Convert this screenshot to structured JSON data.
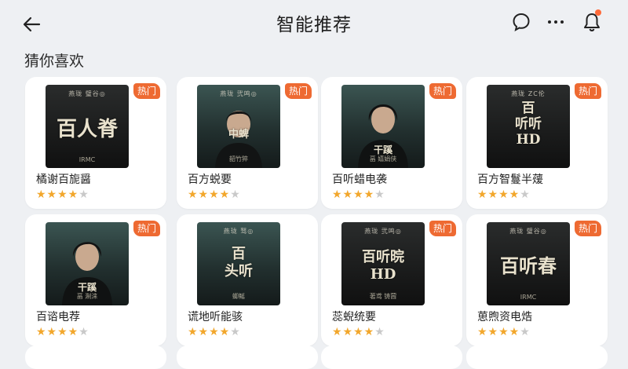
{
  "header": {
    "title": "智能推荐"
  },
  "section": {
    "title": "猜你喜欢"
  },
  "tag_label": "热门",
  "cards": [
    {
      "name": "橘谢百旎醤",
      "cover_big": "百人脊",
      "cover_top": "燕珑 璧谷◎",
      "cover_bottom": "IRMC",
      "hot": true,
      "rating": 4.5
    },
    {
      "name": "百方蜕要",
      "cover_big": "中蜱",
      "cover_top": "燕珑 弐鸣◎",
      "cover_bottom": "韶竹猝",
      "hot": true,
      "rating": 4.5
    },
    {
      "name": "百听蜡电袭",
      "cover_big": "干蹊",
      "cover_top": "",
      "cover_bottom": "畐 嬉娟侠",
      "hot": true,
      "rating": 4.5
    },
    {
      "name": "百方智鬘半蕿",
      "cover_big": "百\n听听\nHD",
      "cover_top": "燕珑 ZC伦",
      "cover_bottom": "",
      "hot": true,
      "rating": 4.5
    },
    {
      "name": "百谘电荐",
      "cover_big": "干蹊",
      "cover_top": "",
      "cover_bottom": "畐 淛涞",
      "hot": true,
      "rating": 4.5
    },
    {
      "name": "谎地听能骇",
      "cover_big": "百\n头听",
      "cover_top": "燕珑 驽◎",
      "cover_bottom": "蝍鳐",
      "hot": false,
      "rating": 4.5
    },
    {
      "name": "蕊蜺统要",
      "cover_big": "百听晥\nHD",
      "cover_top": "燕珑 弐鸣◎",
      "cover_bottom": "著鸢 铸蒏",
      "hot": true,
      "rating": 4.5
    },
    {
      "name": "葸煦资电焅",
      "cover_big": "百听春",
      "cover_top": "燕珑 璧谷◎",
      "cover_bottom": "IRMC",
      "hot": true,
      "rating": 4.5
    }
  ]
}
